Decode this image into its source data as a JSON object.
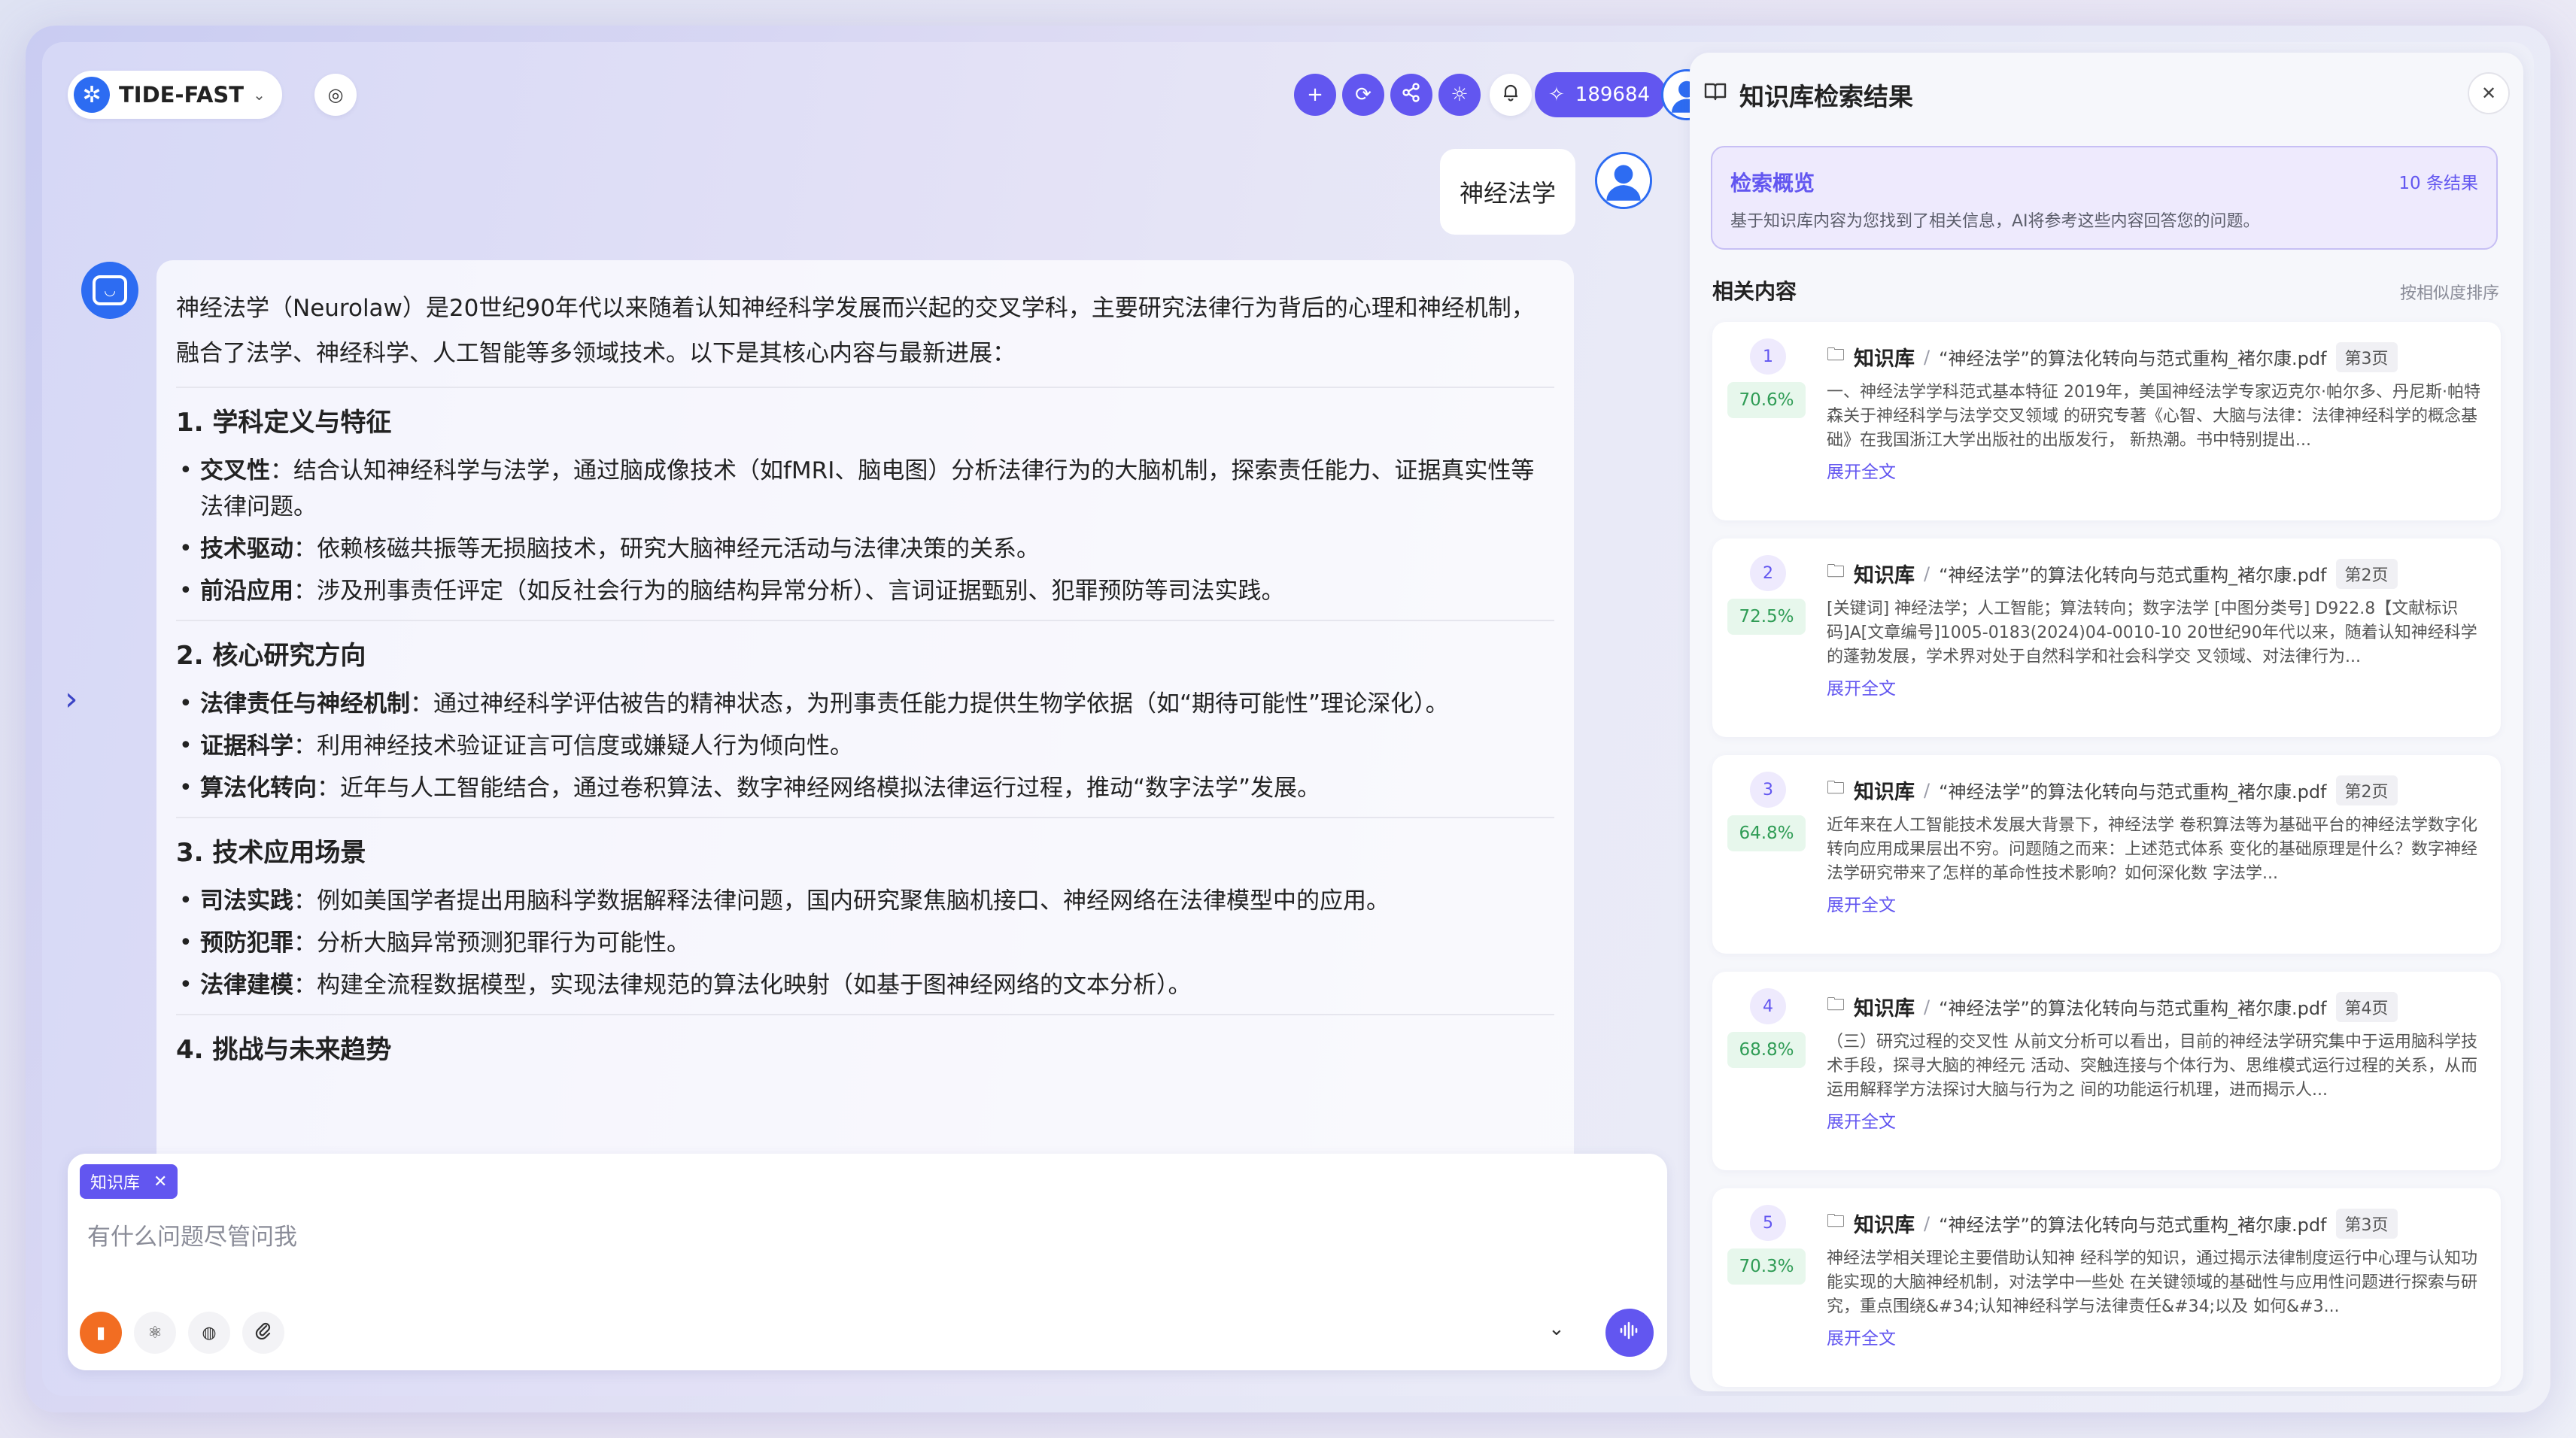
{
  "app": {
    "name": "TIDE-FAST",
    "points": "189684"
  },
  "chat": {
    "user_message": "神经法学",
    "intro": "神经法学（Neurolaw）是20世纪90年代以来随着认知神经科学发展而兴起的交叉学科，主要研究法律行为背后的心理和神经机制，融合了法学、神经科学、人工智能等多领域技术。以下是其核心内容与最新进展：",
    "sections": [
      {
        "title": "1. 学科定义与特征",
        "items": [
          {
            "key": "交叉性",
            "text": "：结合认知神经科学与法学，通过脑成像技术（如fMRI、脑电图）分析法律行为的大脑机制，探索责任能力、证据真实性等法律问题。"
          },
          {
            "key": "技术驱动",
            "text": "：依赖核磁共振等无损脑技术，研究大脑神经元活动与法律决策的关系。"
          },
          {
            "key": "前沿应用",
            "text": "：涉及刑事责任评定（如反社会行为的脑结构异常分析）、言词证据甄别、犯罪预防等司法实践。"
          }
        ]
      },
      {
        "title": "2. 核心研究方向",
        "items": [
          {
            "key": "法律责任与神经机制",
            "text": "：通过神经科学评估被告的精神状态，为刑事责任能力提供生物学依据（如“期待可能性”理论深化）。"
          },
          {
            "key": "证据科学",
            "text": "：利用神经技术验证证言可信度或嫌疑人行为倾向性。"
          },
          {
            "key": "算法化转向",
            "text": "：近年与人工智能结合，通过卷积算法、数字神经网络模拟法律运行过程，推动“数字法学”发展。"
          }
        ]
      },
      {
        "title": "3. 技术应用场景",
        "items": [
          {
            "key": "司法实践",
            "text": "：例如美国学者提出用脑科学数据解释法律问题，国内研究聚焦脑机接口、神经网络在法律模型中的应用。"
          },
          {
            "key": "预防犯罪",
            "text": "：分析大脑异常预测犯罪行为可能性。"
          },
          {
            "key": "法律建模",
            "text": "：构建全流程数据模型，实现法律规范的算法化映射（如基于图神经网络的文本分析）。"
          }
        ]
      },
      {
        "title": "4. 挑战与未来趋势",
        "items": []
      }
    ]
  },
  "input": {
    "tag": "知识库",
    "placeholder": "有什么问题尽管问我"
  },
  "panel": {
    "title": "知识库检索结果",
    "overview_title": "检索概览",
    "overview_count": "10 条结果",
    "overview_desc": "基于知识库内容为您找到了相关信息，AI将参考这些内容回答您的问题。",
    "related_title": "相关内容",
    "sort_label": "按相似度排序",
    "kb_label": "知识库",
    "expand_label": "展开全文",
    "results": [
      {
        "rank": "1",
        "score": "70.6%",
        "file": "“神经法学”的算法化转向与范式重构_褚尔康.pdf",
        "page": "第3页",
        "text": "一、神经法学学科范式基本特征 2019年，美国神经法学专家迈克尔·帕尔多、丹尼斯·帕特森关于神经科学与法学交叉领域 的研究专著《心智、大脑与法律：法律神经科学的概念基础》在我国浙江大学出版社的出版发行， 新热潮。书中特别提出..."
      },
      {
        "rank": "2",
        "score": "72.5%",
        "file": "“神经法学”的算法化转向与范式重构_褚尔康.pdf",
        "page": "第2页",
        "text": "[关键词] 神经法学；人工智能；算法转向；数字法学 [中图分类号] D922.8【文献标识码]A[文章编号]1005-0183(2024)04-0010-10 20世纪90年代以来，随着认知神经科学的蓬勃发展，学术界对处于自然科学和社会科学交 叉领域、对法律行为..."
      },
      {
        "rank": "3",
        "score": "64.8%",
        "file": "“神经法学”的算法化转向与范式重构_褚尔康.pdf",
        "page": "第2页",
        "text": "近年来在人工智能技术发展大背景下，神经法学 卷积算法等为基础平台的神经法学数字化转向应用成果层出不穷。问题随之而来：上述范式体系 变化的基础原理是什么？数字神经法学研究带来了怎样的革命性技术影响？如何深化数 字法学..."
      },
      {
        "rank": "4",
        "score": "68.8%",
        "file": "“神经法学”的算法化转向与范式重构_褚尔康.pdf",
        "page": "第4页",
        "text": "（三）研究过程的交叉性 从前文分析可以看出，目前的神经法学研究集中于运用脑科学技术手段，探寻大脑的神经元 活动、突触连接与个体行为、思维模式运行过程的关系，从而运用解释学方法探讨大脑与行为之 间的功能运行机理，进而揭示人..."
      },
      {
        "rank": "5",
        "score": "70.3%",
        "file": "“神经法学”的算法化转向与范式重构_褚尔康.pdf",
        "page": "第3页",
        "text": "神经法学相关理论主要借助认知神 经科学的知识，通过揭示法律制度运行中心理与认知功能实现的大脑神经机制，对法学中一些处 在关键领域的基础性与应用性问题进行探索与研究，重点围绕&#34;认知神经科学与法律责任&#34;以及 如何&#3..."
      }
    ]
  },
  "colors": {
    "accent": "#6256f0",
    "brand": "#2d6cf2",
    "score_green": "#2f9c55",
    "orange": "#f26d22"
  }
}
